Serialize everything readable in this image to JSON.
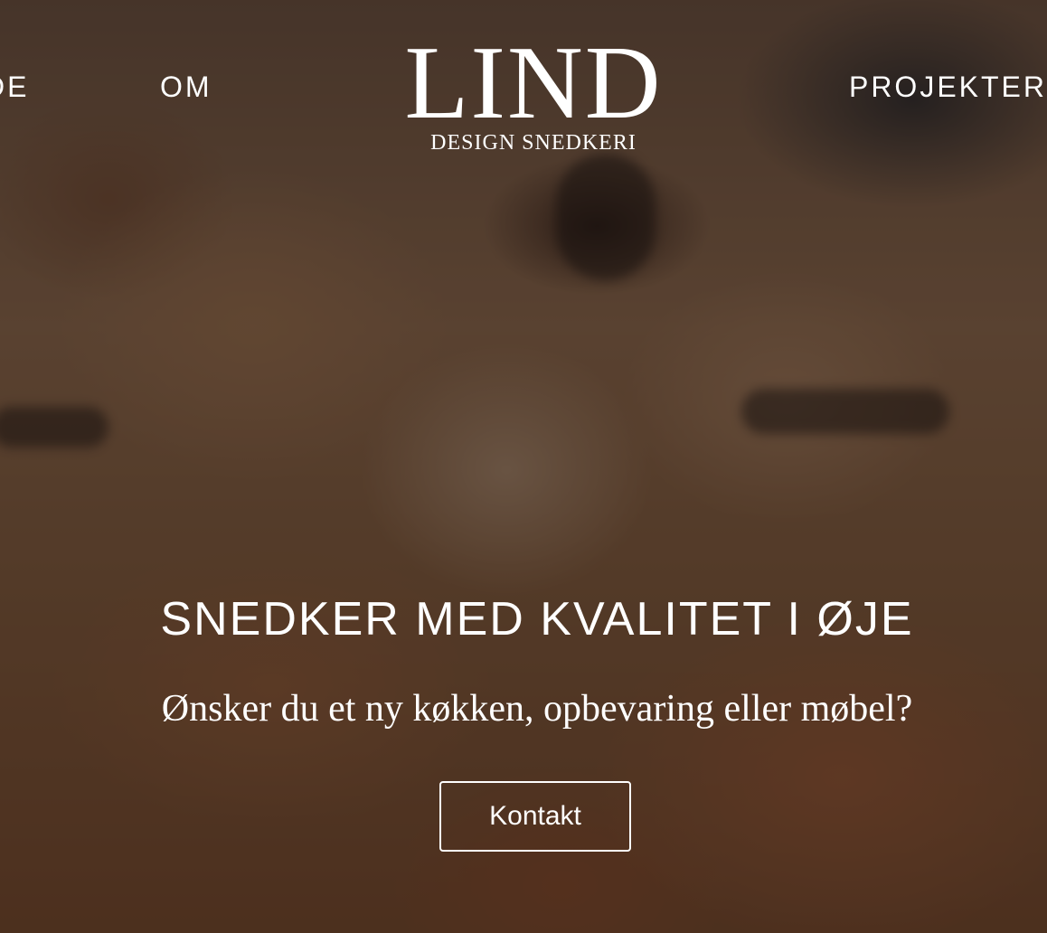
{
  "nav": {
    "left_items": [
      {
        "label": "DE"
      },
      {
        "label": "OM"
      }
    ],
    "right_items": [
      {
        "label": "PROJEKTER"
      }
    ]
  },
  "logo": {
    "main": "LIND",
    "sub": "DESIGN SNEDKERI"
  },
  "hero": {
    "title": "SNEDKER MED KVALITET I ØJE",
    "subtitle": "Ønsker du et ny køkken, opbevaring eller møbel?",
    "cta_label": "Kontakt"
  },
  "colors": {
    "text": "#ffffff",
    "overlay": "#140e0a",
    "wood": "#b88a66"
  }
}
